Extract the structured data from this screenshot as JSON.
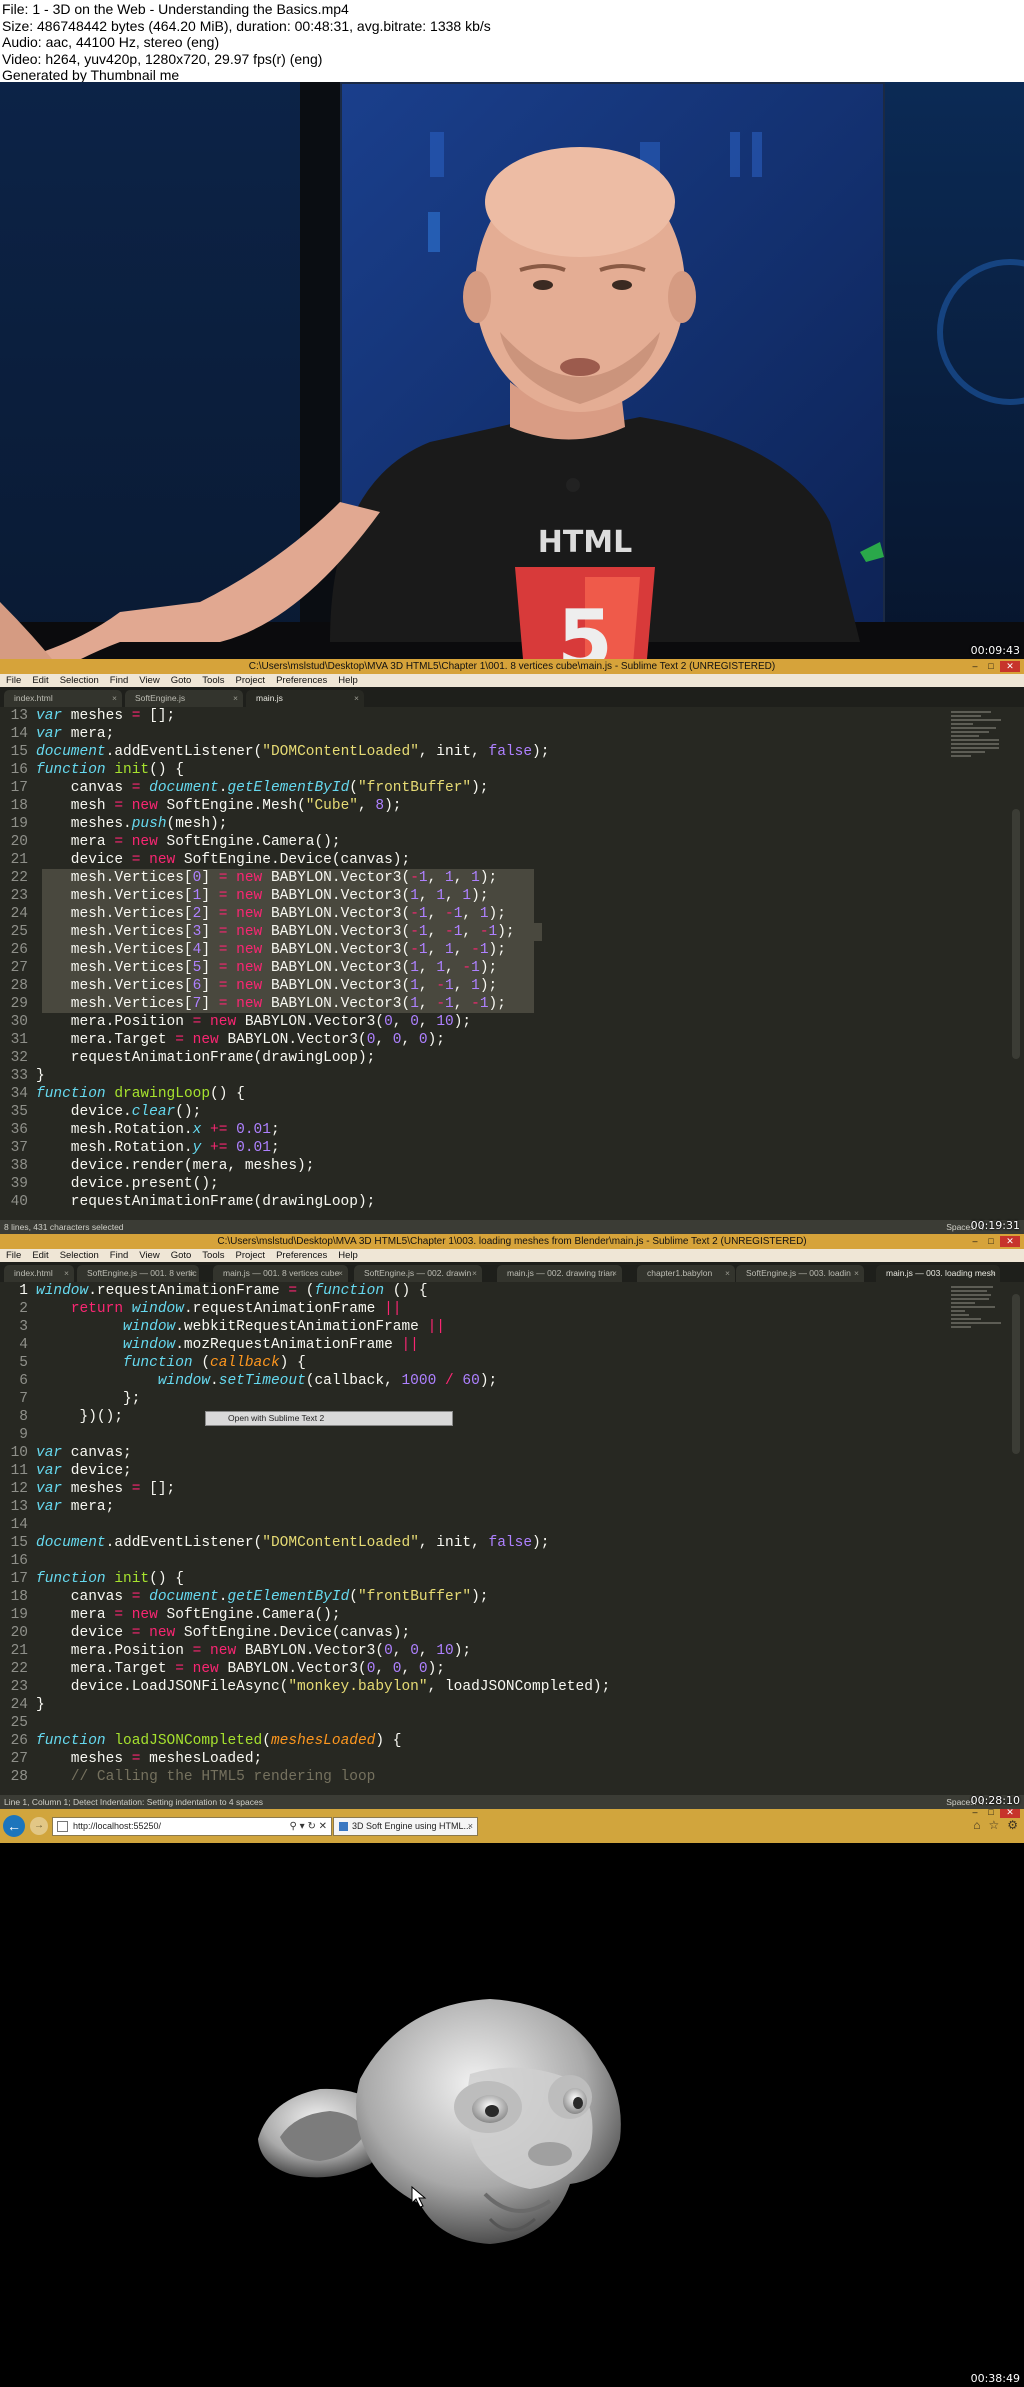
{
  "header": {
    "line1": "File: 1 - 3D on the Web - Understanding the Basics.mp4",
    "line2": "Size: 486748442 bytes (464.20 MiB), duration: 00:48:31, avg.bitrate: 1338 kb/s",
    "line3": "Audio: aac, 44100 Hz, stereo (eng)",
    "line4": "Video: h264, yuv420p, 1280x720, 29.97 fps(r) (eng)",
    "line5": "Generated by Thumbnail me"
  },
  "frames": {
    "frame1": {
      "timestamp": "00:09:43",
      "shirt_text": "HTML"
    },
    "frame2": {
      "title": "C:\\Users\\mslstud\\Desktop\\MVA 3D HTML5\\Chapter 1\\001. 8 vertices cube\\main.js - Sublime Text 2 (UNREGISTERED)",
      "menu": [
        "File",
        "Edit",
        "Selection",
        "Find",
        "View",
        "Goto",
        "Tools",
        "Project",
        "Preferences",
        "Help"
      ],
      "tabs": [
        "index.html",
        "SoftEngine.js",
        "main.js"
      ],
      "status_left": "8 lines, 431 characters selected",
      "status_right": "Spaces: 4",
      "timestamp": "00:19:31"
    },
    "frame3": {
      "title": "C:\\Users\\mslstud\\Desktop\\MVA 3D HTML5\\Chapter 1\\003. loading meshes from Blender\\main.js - Sublime Text 2 (UNREGISTERED)",
      "menu": [
        "File",
        "Edit",
        "Selection",
        "Find",
        "View",
        "Goto",
        "Tools",
        "Project",
        "Preferences",
        "Help"
      ],
      "tabs": [
        "index.html",
        "SoftEngine.js — 001. 8 vertic",
        "main.js — 001. 8 vertices cube",
        "SoftEngine.js — 002. drawin",
        "main.js — 002. drawing trian",
        "chapter1.babylon",
        "SoftEngine.js — 003. loadin",
        "main.js — 003. loading mesh"
      ],
      "context_menu": "Open with Sublime Text 2",
      "status_left": "Line 1, Column 1; Detect Indentation: Setting indentation to 4 spaces",
      "status_right": "Spaces: 4",
      "timestamp": "00:28:10"
    },
    "frame4": {
      "address": "http://localhost:55250/",
      "tab_title": "3D Soft Engine using HTML...",
      "timestamp": "00:38:49"
    }
  },
  "colors": {
    "editor_bg": "#272822",
    "title_bar": "#d6a33a",
    "keyword": "#f92672",
    "storage": "#66d9ef",
    "function": "#a6e22e",
    "string": "#e6db74",
    "number": "#ae81ff"
  },
  "icons": [
    "close-icon",
    "maximize-icon",
    "minimize-icon",
    "back-arrow-icon",
    "forward-arrow-icon",
    "search-icon",
    "refresh-icon",
    "home-icon",
    "star-icon",
    "gear-icon"
  ]
}
